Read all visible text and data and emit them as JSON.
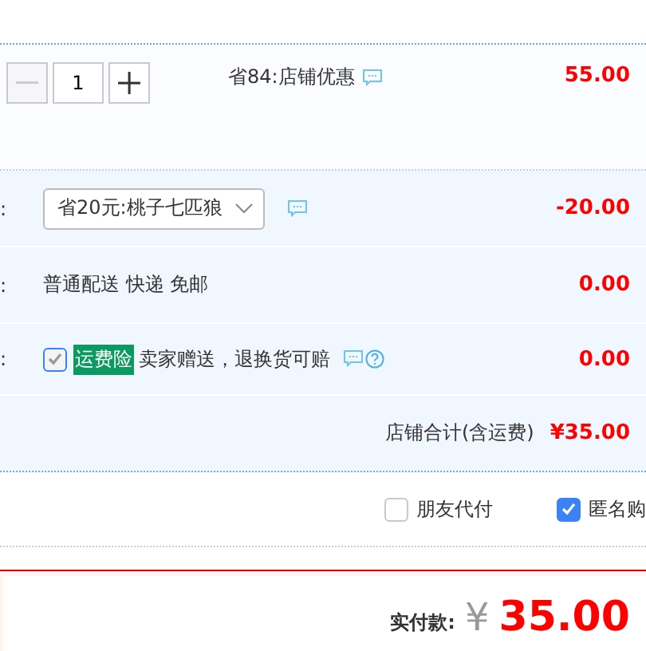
{
  "item": {
    "quantity": "1",
    "minus_disabled": true,
    "promo": "省84:店铺优惠",
    "price": "55.00"
  },
  "rows": [
    {
      "kind": "select",
      "label": ":",
      "value": "省20元:桃子七匹狼",
      "amount": "-20.00"
    },
    {
      "kind": "text",
      "label": ":",
      "value": "普通配送 快递 免邮",
      "amount": "0.00"
    },
    {
      "kind": "insurance",
      "label": ":",
      "checked": true,
      "disabled": true,
      "tag": "运费险",
      "value": "卖家赠送，退换货可赔",
      "amount": "0.00"
    }
  ],
  "store_total": {
    "label": "店铺合计(含运费)",
    "value": "¥35.00"
  },
  "options": [
    {
      "label": "朋友代付",
      "checked": false
    },
    {
      "label": "匿名购",
      "checked": true
    }
  ],
  "payment": {
    "label": "实付款:",
    "currency": "¥",
    "amount": "35.00"
  }
}
